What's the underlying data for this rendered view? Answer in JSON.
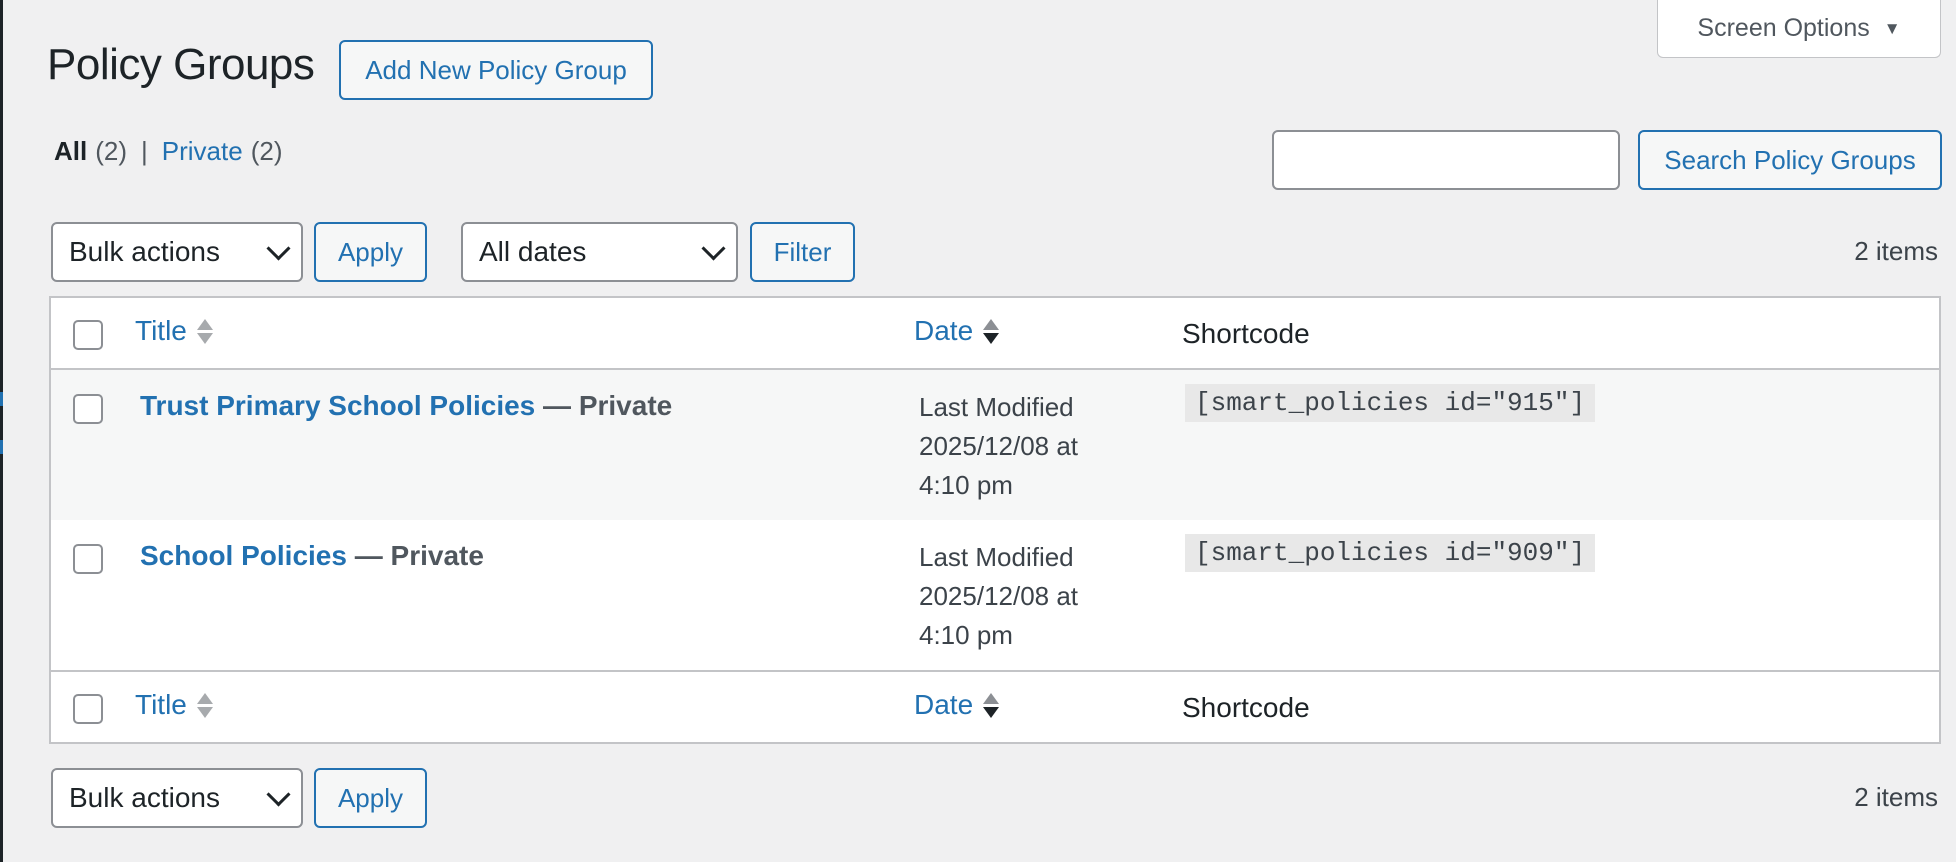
{
  "screen_options": {
    "label": "Screen Options"
  },
  "page": {
    "title": "Policy Groups",
    "add_new_label": "Add New Policy Group"
  },
  "views": {
    "all_label": "All",
    "all_count": "(2)",
    "separator": "|",
    "private_label": "Private",
    "private_count": "(2)"
  },
  "search": {
    "value": "",
    "placeholder": "",
    "button_label": "Search Policy Groups"
  },
  "top_nav": {
    "bulk_actions": "Bulk actions",
    "apply_label": "Apply",
    "date_filter": "All dates",
    "filter_label": "Filter",
    "items_count": "2 items"
  },
  "bottom_nav": {
    "bulk_actions": "Bulk actions",
    "apply_label": "Apply",
    "items_count": "2 items"
  },
  "columns": {
    "title": "Title",
    "date": "Date",
    "shortcode": "Shortcode"
  },
  "rows": [
    {
      "title": "Trust Primary School Policies",
      "state": "— Private",
      "date_line1": "Last Modified",
      "date_line2": "2025/12/08 at",
      "date_line3": "4:10 pm",
      "shortcode": "[smart_policies id=\"915\"]"
    },
    {
      "title": "School Policies",
      "state": "— Private",
      "date_line1": "Last Modified",
      "date_line2": "2025/12/08 at",
      "date_line3": "4:10 pm",
      "shortcode": "[smart_policies id=\"909\"]"
    }
  ],
  "colors": {
    "accent": "#2271b1",
    "background": "#f0f0f1",
    "text": "#1d2327"
  }
}
